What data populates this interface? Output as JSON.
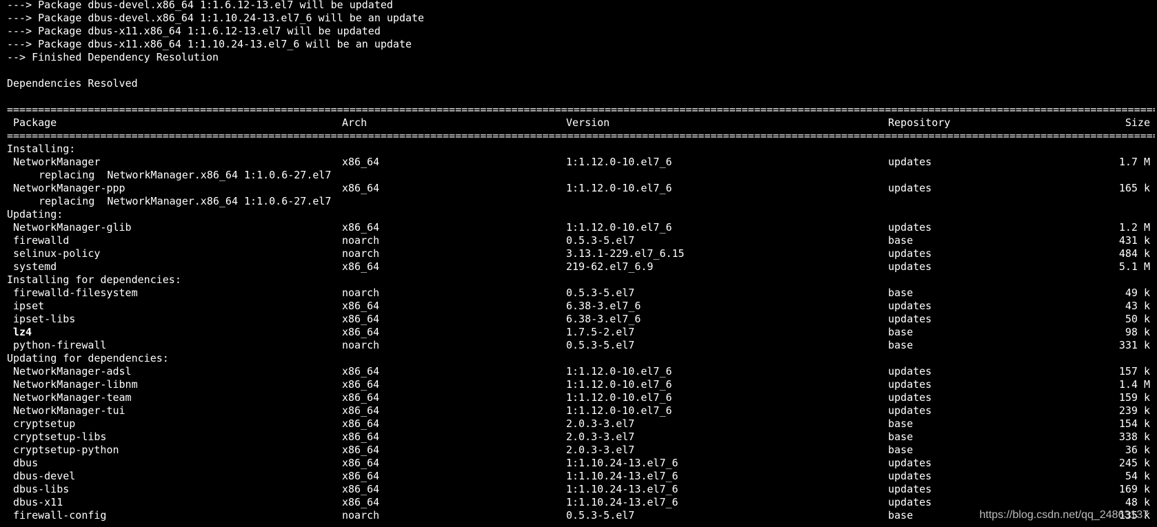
{
  "terminal": {
    "pre_lines": [
      "---> Package dbus-devel.x86_64 1:1.6.12-13.el7 will be updated",
      "---> Package dbus-devel.x86_64 1:1.10.24-13.el7_6 will be an update",
      "---> Package dbus-x11.x86_64 1:1.6.12-13.el7 will be updated",
      "---> Package dbus-x11.x86_64 1:1.10.24-13.el7_6 will be an update",
      "--> Finished Dependency Resolution",
      "",
      "Dependencies Resolved",
      ""
    ],
    "separator": "================================================================================================================================================================================================================================================================================",
    "headers": {
      "package": "Package",
      "arch": "Arch",
      "version": "Version",
      "repository": "Repository",
      "size": "Size"
    },
    "rows": [
      {
        "type": "section",
        "text": "Installing:"
      },
      {
        "type": "pkg",
        "name": "NetworkManager",
        "arch": "x86_64",
        "version": "1:1.12.0-10.el7_6",
        "repo": "updates",
        "size": "1.7 M"
      },
      {
        "type": "note",
        "text": "replacing  NetworkManager.x86_64 1:1.0.6-27.el7"
      },
      {
        "type": "pkg",
        "name": "NetworkManager-ppp",
        "arch": "x86_64",
        "version": "1:1.12.0-10.el7_6",
        "repo": "updates",
        "size": "165 k"
      },
      {
        "type": "note",
        "text": "replacing  NetworkManager.x86_64 1:1.0.6-27.el7"
      },
      {
        "type": "section",
        "text": "Updating:"
      },
      {
        "type": "pkg",
        "name": "NetworkManager-glib",
        "arch": "x86_64",
        "version": "1:1.12.0-10.el7_6",
        "repo": "updates",
        "size": "1.2 M"
      },
      {
        "type": "pkg",
        "name": "firewalld",
        "arch": "noarch",
        "version": "0.5.3-5.el7",
        "repo": "base",
        "size": "431 k"
      },
      {
        "type": "pkg",
        "name": "selinux-policy",
        "arch": "noarch",
        "version": "3.13.1-229.el7_6.15",
        "repo": "updates",
        "size": "484 k"
      },
      {
        "type": "pkg",
        "name": "systemd",
        "arch": "x86_64",
        "version": "219-62.el7_6.9",
        "repo": "updates",
        "size": "5.1 M"
      },
      {
        "type": "section",
        "text": "Installing for dependencies:"
      },
      {
        "type": "pkg",
        "name": "firewalld-filesystem",
        "arch": "noarch",
        "version": "0.5.3-5.el7",
        "repo": "base",
        "size": "49 k"
      },
      {
        "type": "pkg",
        "name": "ipset",
        "arch": "x86_64",
        "version": "6.38-3.el7_6",
        "repo": "updates",
        "size": "43 k"
      },
      {
        "type": "pkg",
        "name": "ipset-libs",
        "arch": "x86_64",
        "version": "6.38-3.el7_6",
        "repo": "updates",
        "size": "50 k"
      },
      {
        "type": "pkg",
        "name": "lz4",
        "arch": "x86_64",
        "version": "1.7.5-2.el7",
        "repo": "base",
        "size": "98 k",
        "bold": true
      },
      {
        "type": "pkg",
        "name": "python-firewall",
        "arch": "noarch",
        "version": "0.5.3-5.el7",
        "repo": "base",
        "size": "331 k"
      },
      {
        "type": "section",
        "text": "Updating for dependencies:"
      },
      {
        "type": "pkg",
        "name": "NetworkManager-adsl",
        "arch": "x86_64",
        "version": "1:1.12.0-10.el7_6",
        "repo": "updates",
        "size": "157 k"
      },
      {
        "type": "pkg",
        "name": "NetworkManager-libnm",
        "arch": "x86_64",
        "version": "1:1.12.0-10.el7_6",
        "repo": "updates",
        "size": "1.4 M"
      },
      {
        "type": "pkg",
        "name": "NetworkManager-team",
        "arch": "x86_64",
        "version": "1:1.12.0-10.el7_6",
        "repo": "updates",
        "size": "159 k"
      },
      {
        "type": "pkg",
        "name": "NetworkManager-tui",
        "arch": "x86_64",
        "version": "1:1.12.0-10.el7_6",
        "repo": "updates",
        "size": "239 k"
      },
      {
        "type": "pkg",
        "name": "cryptsetup",
        "arch": "x86_64",
        "version": "2.0.3-3.el7",
        "repo": "base",
        "size": "154 k"
      },
      {
        "type": "pkg",
        "name": "cryptsetup-libs",
        "arch": "x86_64",
        "version": "2.0.3-3.el7",
        "repo": "base",
        "size": "338 k"
      },
      {
        "type": "pkg",
        "name": "cryptsetup-python",
        "arch": "x86_64",
        "version": "2.0.3-3.el7",
        "repo": "base",
        "size": "36 k"
      },
      {
        "type": "pkg",
        "name": "dbus",
        "arch": "x86_64",
        "version": "1:1.10.24-13.el7_6",
        "repo": "updates",
        "size": "245 k"
      },
      {
        "type": "pkg",
        "name": "dbus-devel",
        "arch": "x86_64",
        "version": "1:1.10.24-13.el7_6",
        "repo": "updates",
        "size": "54 k"
      },
      {
        "type": "pkg",
        "name": "dbus-libs",
        "arch": "x86_64",
        "version": "1:1.10.24-13.el7_6",
        "repo": "updates",
        "size": "169 k"
      },
      {
        "type": "pkg",
        "name": "dbus-x11",
        "arch": "x86_64",
        "version": "1:1.10.24-13.el7_6",
        "repo": "updates",
        "size": "48 k"
      },
      {
        "type": "pkg",
        "name": "firewall-config",
        "arch": "noarch",
        "version": "0.5.3-5.el7",
        "repo": "base",
        "size": "135 k"
      }
    ]
  },
  "watermark": "https://blog.csdn.net/qq_24863137",
  "colors": {
    "background": "#000000",
    "text": "#ffffff",
    "watermark": "#bdbdbd"
  }
}
